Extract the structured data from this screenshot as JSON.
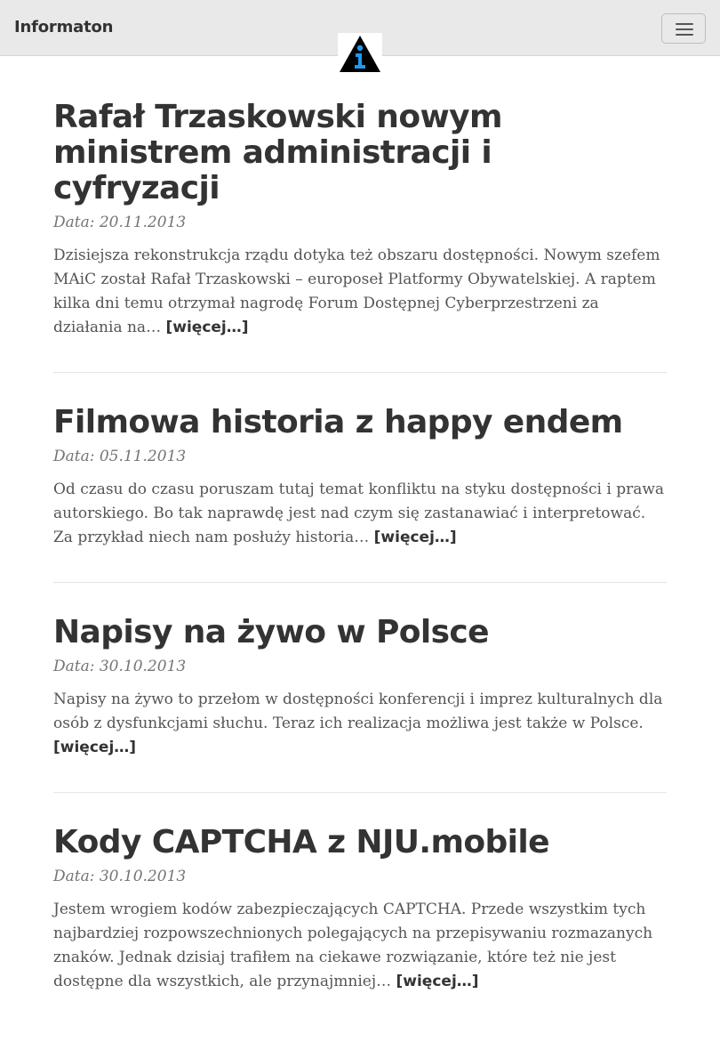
{
  "navbar": {
    "brand": "Informaton",
    "toggle_icon": "hamburger-menu-icon",
    "logo_icon": "information-triangle-logo"
  },
  "posts": [
    {
      "title": "Rafał Trzaskowski nowym ministrem administracji i cyfryzacji",
      "date": "Data: 20.11.2013",
      "excerpt": "Dzisiejsza rekonstrukcja rządu dotyka też obszaru dostępności. Nowym szefem MAiC został Rafał Trzaskowski – europoseł Platformy Obywatelskiej. A raptem kilka dni temu otrzymał nagrodę Forum Dostępnej Cyberprzestrzeni za działania na… ",
      "more": "[więcej…]"
    },
    {
      "title": "Filmowa historia z happy endem",
      "date": "Data: 05.11.2013",
      "excerpt": "Od czasu do czasu poruszam tutaj temat konfliktu na styku dostępności i prawa autorskiego. Bo tak naprawdę jest nad czym się zastanawiać i interpretować. Za przykład niech nam posłuży historia… ",
      "more": "[więcej…]"
    },
    {
      "title": "Napisy na żywo w Polsce",
      "date": "Data: 30.10.2013",
      "excerpt": "Napisy na żywo to przełom w dostępności konferencji i imprez kulturalnych dla osób z dysfunkcjami słuchu. Teraz ich realizacja możliwa jest także w Polsce. ",
      "more": "[więcej…]"
    },
    {
      "title": "Kody CAPTCHA z NJU.mobile",
      "date": "Data: 30.10.2013",
      "excerpt": "Jestem wrogiem kodów zabezpieczających CAPTCHA. Przede wszystkim tych najbardziej rozpowszechnionych polegających na przepisywaniu rozmazanych znaków. Jednak dzisiaj trafiłem na ciekawe rozwiązanie, które też nie jest dostępne dla wszystkich, ale przynajmniej… ",
      "more": "[więcej…]"
    }
  ]
}
